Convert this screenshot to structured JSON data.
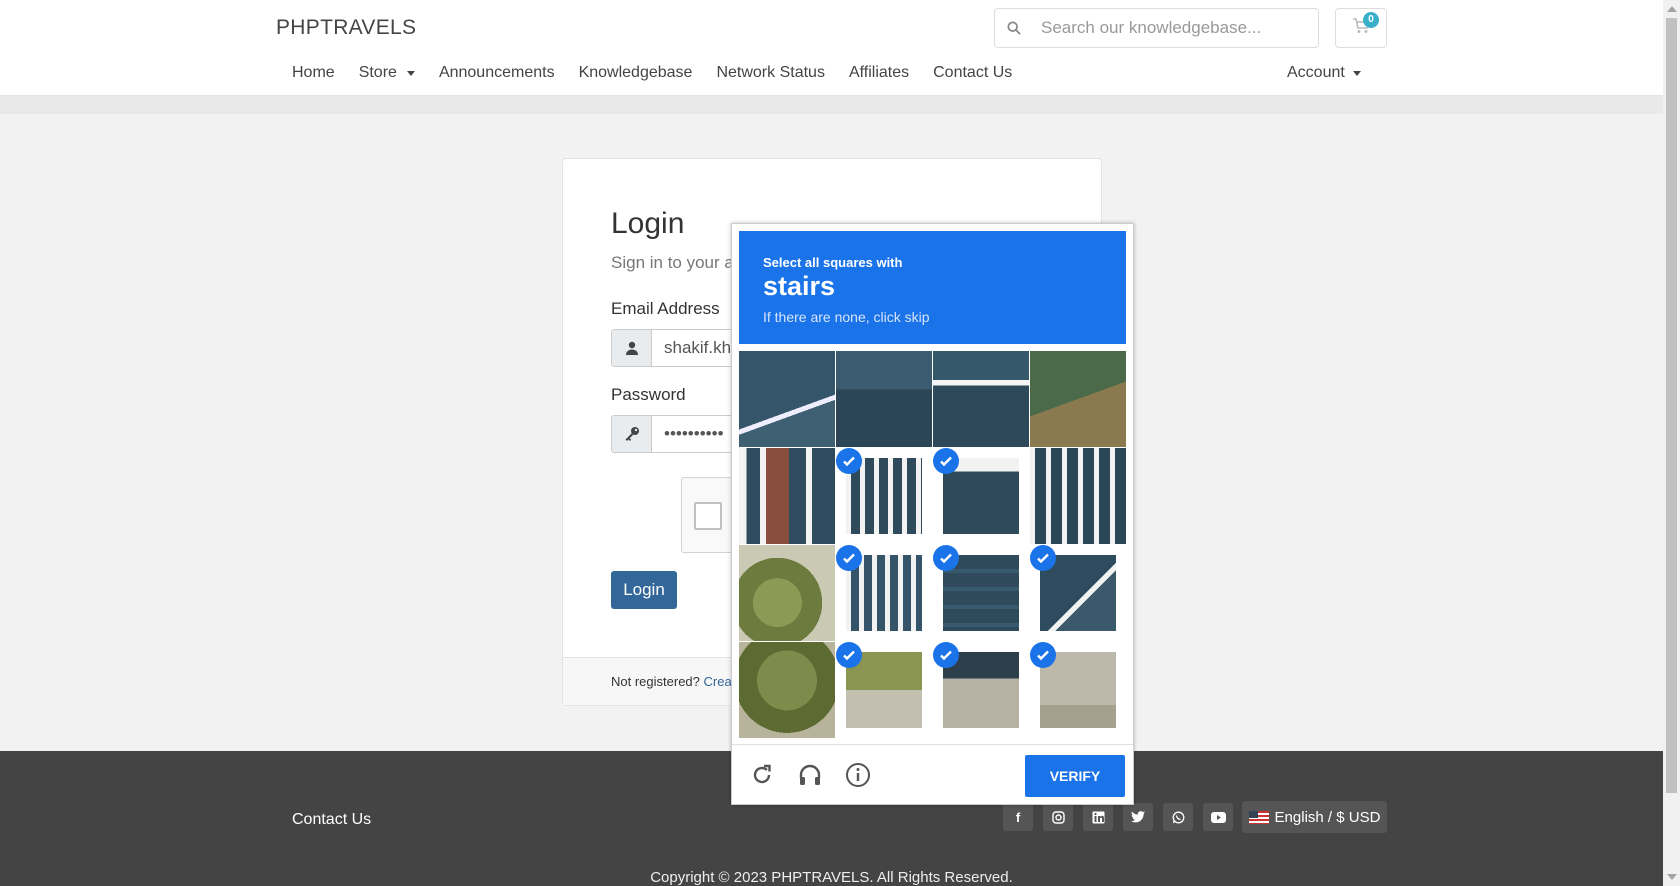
{
  "header": {
    "brand": "PHPTRAVELS",
    "search_placeholder": "Search our knowledgebase...",
    "cart_count": "0",
    "nav": [
      "Home",
      "Store",
      "Announcements",
      "Knowledgebase",
      "Network Status",
      "Affiliates",
      "Contact Us"
    ],
    "account_label": "Account"
  },
  "login": {
    "title": "Login",
    "subtitle": "Sign in to your a",
    "email_label": "Email Address",
    "email_value": "shakif.kh",
    "password_label": "Password",
    "password_value": "••••••••••",
    "login_button": "Login",
    "not_registered": "Not registered?",
    "create_link": "Crea"
  },
  "captcha": {
    "instruction": "Select all squares with",
    "target": "stairs",
    "hint": "If there are none, click skip",
    "verify_label": "VERIFY",
    "selected_tiles": [
      5,
      6,
      9,
      10,
      11,
      13,
      14,
      15
    ]
  },
  "footer": {
    "contact": "Contact Us",
    "social": [
      "facebook-icon",
      "instagram-icon",
      "linkedin-icon",
      "twitter-icon",
      "whatsapp-icon",
      "youtube-icon"
    ],
    "language": "English / $ USD",
    "copyright": "Copyright © 2023 PHPTRAVELS. All Rights Reserved."
  },
  "colors": {
    "captcha_blue": "#1a73e8",
    "login_button": "#336699",
    "footer_bg": "#444444"
  }
}
